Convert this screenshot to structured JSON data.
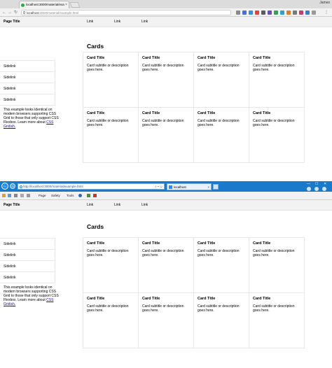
{
  "chrome": {
    "tab_title": "localhost:3000/material/exa",
    "user": "James",
    "url_host": "localhost",
    "url_path": ":3000/material/example.html"
  },
  "ie": {
    "url": "http://localhost:3000/material/example.html",
    "tab_title": "localhost",
    "commands": [
      "Page",
      "Safety",
      "Tools"
    ]
  },
  "page": {
    "title": "Page Title",
    "links": [
      "Link",
      "Link",
      "Link"
    ],
    "heading": "Cards",
    "sidelinks": [
      "Sidelink",
      "Sidelink",
      "Sidelink",
      "Sidelink"
    ],
    "note_text": "This example looks identical on modern browsers supporting CSS Grid to those that only support CSS Flexbox. Learn more about",
    "note_link": "CSS Gridish.",
    "cards": [
      {
        "title": "Card Title",
        "subtitle": "Card subtitle or description goes here."
      },
      {
        "title": "Card Title",
        "subtitle": "Card subtitle or description goes here."
      },
      {
        "title": "Card Title",
        "subtitle": "Card subtitle or description goes here."
      },
      {
        "title": "Card Title",
        "subtitle": "Card subtitle or description goes here."
      },
      {
        "title": "Card Title",
        "subtitle": "Card subtitle or description goes here."
      },
      {
        "title": "Card Title",
        "subtitle": "Card subtitle or description goes here."
      },
      {
        "title": "Card Title",
        "subtitle": "Card subtitle or description goes here."
      },
      {
        "title": "Card Title",
        "subtitle": "Card subtitle or description goes here."
      }
    ]
  }
}
